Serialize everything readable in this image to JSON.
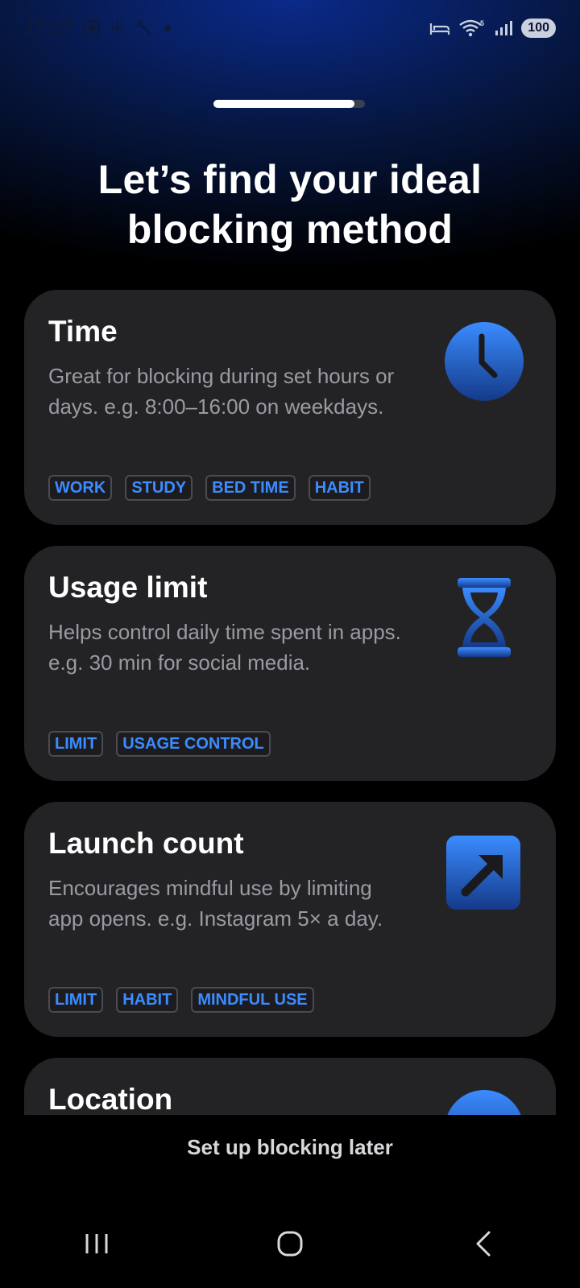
{
  "status_bar": {
    "time": "17:27",
    "battery": "100",
    "icons_left": [
      "screenshot-icon",
      "usb-icon",
      "magic-wand-icon",
      "dot-icon"
    ],
    "icons_right": [
      "sleep-mode-icon",
      "wifi-icon",
      "signal-icon",
      "battery-icon"
    ]
  },
  "progress": {
    "value": 0.93
  },
  "header": {
    "title_line1": "Let’s find your ideal",
    "title_line2": "blocking method"
  },
  "methods": [
    {
      "title": "Time",
      "description": "Great for blocking during set hours or days. e.g. 8:00–16:00 on weekdays.",
      "tags": [
        "WORK",
        "STUDY",
        "BED TIME",
        "HABIT"
      ],
      "icon": "clock-icon"
    },
    {
      "title": "Usage limit",
      "description": "Helps control daily time spent in apps. e.g. 30 min for social media.",
      "tags": [
        "LIMIT",
        "USAGE CONTROL"
      ],
      "icon": "hourglass-icon"
    },
    {
      "title": "Launch count",
      "description": "Encourages mindful use by limiting app opens. e.g. Instagram 5× a day.",
      "tags": [
        "LIMIT",
        "HABIT",
        "MINDFUL USE"
      ],
      "icon": "launch-arrow-icon"
    },
    {
      "title": "Location",
      "icon": "location-icon"
    }
  ],
  "footer": {
    "later_label": "Set up blocking later"
  },
  "nav": {
    "icons": [
      "recent-apps-icon",
      "home-icon",
      "back-icon"
    ]
  },
  "colors": {
    "accent": "#3b8cff",
    "card_bg": "#232326",
    "tag_text": "#3b8cff"
  }
}
